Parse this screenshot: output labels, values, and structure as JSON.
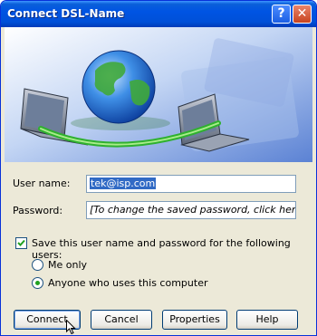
{
  "window": {
    "title": "Connect DSL-Name"
  },
  "titlebar": {
    "help_label": "?",
    "close_label": "✕"
  },
  "form": {
    "user_label": "User name:",
    "user_value": "tek@isp.com",
    "password_label": "Password:",
    "password_value": "[To change the saved password, click here]",
    "save_label": "Save this user name and password for the following users:",
    "save_checked": true,
    "me_only_label": "Me only",
    "anyone_label": "Anyone who uses this computer",
    "selected": "anyone"
  },
  "buttons": {
    "connect": "Connect",
    "cancel": "Cancel",
    "properties": "Properties",
    "help": "Help"
  },
  "colors": {
    "titlebar": "#0054e3",
    "selection": "#316ac5",
    "dialog_bg": "#ece9d8"
  },
  "icons": [
    "globe-icon",
    "laptop-icon",
    "help-icon",
    "close-icon",
    "cursor-icon"
  ]
}
